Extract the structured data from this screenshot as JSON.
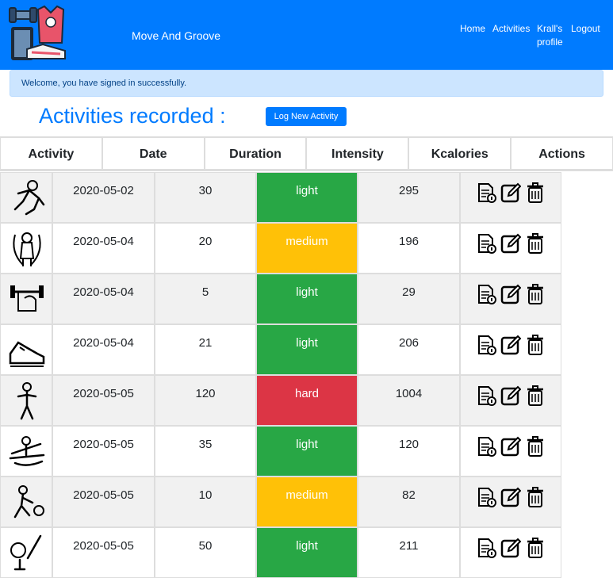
{
  "nav": {
    "brand": "Move And Groove",
    "links": [
      "Home",
      "Activities",
      "Krall's profile",
      "Logout"
    ]
  },
  "alert": {
    "message": "Welcome, you have signed in successfully."
  },
  "page": {
    "title": "Activities recorded :",
    "log_button": "Log New Activity"
  },
  "table": {
    "headers": [
      "Activity",
      "Date",
      "Duration",
      "Intensity",
      "Kcalories",
      "Actions"
    ],
    "rows": [
      {
        "icon": "karate-icon",
        "date": "2020-05-02",
        "duration": "30",
        "intensity": "light",
        "kcal": "295"
      },
      {
        "icon": "jump-rope-icon",
        "date": "2020-05-04",
        "duration": "20",
        "intensity": "medium",
        "kcal": "196"
      },
      {
        "icon": "weightlifting-icon",
        "date": "2020-05-04",
        "duration": "5",
        "intensity": "light",
        "kcal": "29"
      },
      {
        "icon": "running-shoe-icon",
        "date": "2020-05-04",
        "duration": "21",
        "intensity": "light",
        "kcal": "206"
      },
      {
        "icon": "walking-icon",
        "date": "2020-05-05",
        "duration": "120",
        "intensity": "hard",
        "kcal": "1004"
      },
      {
        "icon": "rowing-icon",
        "date": "2020-05-05",
        "duration": "35",
        "intensity": "light",
        "kcal": "120"
      },
      {
        "icon": "volleyball-icon",
        "date": "2020-05-05",
        "duration": "10",
        "intensity": "medium",
        "kcal": "82"
      },
      {
        "icon": "golf-icon",
        "date": "2020-05-05",
        "duration": "50",
        "intensity": "light",
        "kcal": "211"
      }
    ]
  },
  "colors": {
    "primary": "#007bff",
    "light": "#28a745",
    "medium": "#ffc107",
    "hard": "#dc3545",
    "alert_bg": "#cce5ff"
  }
}
